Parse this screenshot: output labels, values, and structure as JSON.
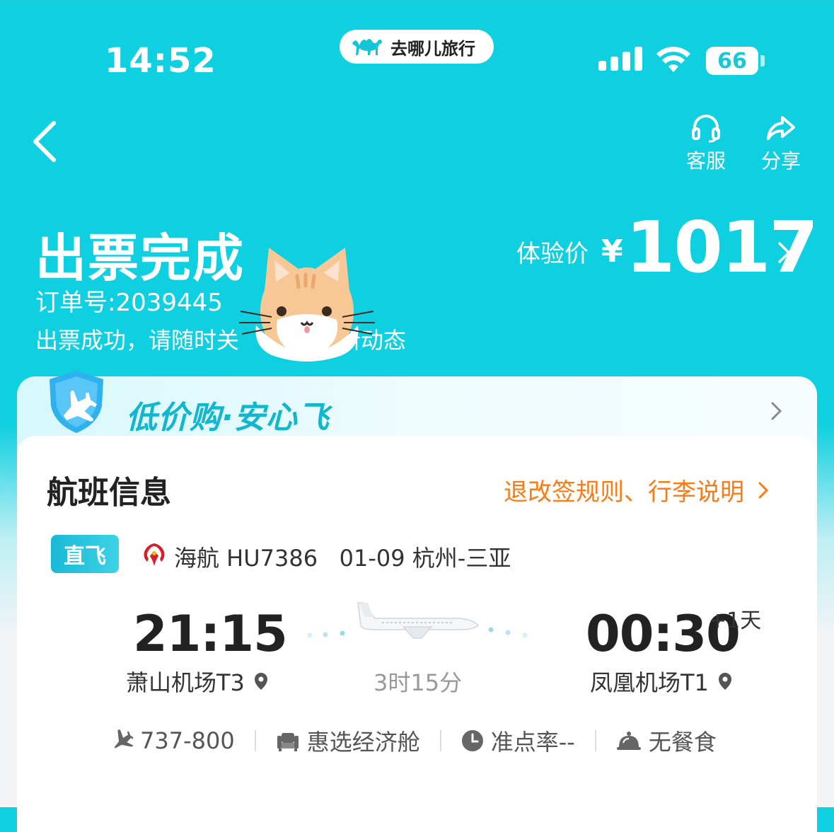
{
  "status_bar": {
    "time": "14:52",
    "app_pill": "去哪儿旅行",
    "battery": "66"
  },
  "nav": {
    "service_label": "客服",
    "share_label": "分享"
  },
  "header": {
    "title": "出票完成",
    "order_number": "订单号:2039445",
    "message_part1": "出票成功，请随时关",
    "message_part2": "新动态",
    "price_label": "体验价",
    "price_symbol": "¥",
    "price_value": "1017"
  },
  "banner": {
    "text": "低价购·安心飞"
  },
  "flight_info": {
    "title": "航班信息",
    "rules_link": "退改签规则、行李说明",
    "tag": "直飞",
    "flight_line": "海航 HU7386   01-09 杭州-三亚",
    "departure_time": "21:15",
    "departure_airport": "萧山机场T3",
    "arrival_time": "00:30",
    "arrival_day_offset": "+1天",
    "arrival_airport": "凤凰机场T1",
    "duration": "3时15分",
    "aircraft": "737-800",
    "cabin": "惠选经济舱",
    "on_time_rate": "准点率--",
    "meal": "无餐食"
  },
  "colors": {
    "header_bg": "#0fd0e0",
    "accent_orange": "#ff7a12",
    "banner_text": "#11b6cf"
  },
  "icons": [
    "camel-icon",
    "signal-icon",
    "wifi-icon",
    "battery-icon",
    "back-arrow-icon",
    "headset-icon",
    "share-icon",
    "cat-sticker",
    "chevron-right-icon",
    "shield-plane-icon",
    "airline-logo-icon",
    "location-pin-icon",
    "airplane-icon",
    "seat-icon",
    "clock-icon",
    "meal-bell-icon"
  ]
}
